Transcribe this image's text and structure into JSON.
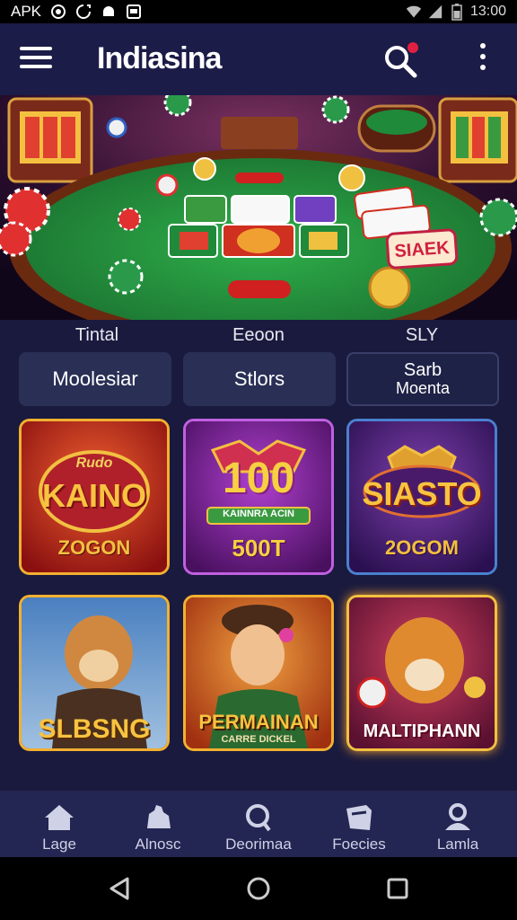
{
  "status_bar": {
    "app_label": "APK",
    "time": "13:00",
    "icons": [
      "notification-icon",
      "sync-icon",
      "android-icon",
      "image-icon",
      "wifi-icon",
      "signal-icon",
      "battery-icon"
    ]
  },
  "header": {
    "title": "Indiasina",
    "icons": [
      "menu-icon",
      "search-icon",
      "more-vert-icon"
    ],
    "notification_dot_color": "#e02040"
  },
  "tabs": [
    {
      "label": "Tintal"
    },
    {
      "label": "Eeoon"
    },
    {
      "label": "SLY"
    }
  ],
  "categories": [
    {
      "label": "Moolesiar"
    },
    {
      "label": "Stlors"
    },
    {
      "label_line1": "Sarb",
      "label_line2": "Moenta"
    }
  ],
  "games": [
    {
      "title": "KAINO",
      "subtitle": "ZOGON",
      "theme": "red",
      "ribbon": "Rudo"
    },
    {
      "title": "100",
      "subtitle": "500T",
      "theme": "purple",
      "ribbon": "KAINNRA ACIN"
    },
    {
      "title": "SIASTO",
      "subtitle": "2OGOM",
      "theme": "violet"
    },
    {
      "title": "SLBSNG",
      "theme": "puma"
    },
    {
      "title": "PERMAINAN",
      "subtitle": "CARRE DICKEL",
      "theme": "portrait"
    },
    {
      "title": "MALTIPHANN",
      "theme": "tiger"
    }
  ],
  "bottom_nav": [
    {
      "label": "Lage",
      "icon": "home-icon"
    },
    {
      "label": "Alnosc",
      "icon": "games-icon"
    },
    {
      "label": "Deorimaa",
      "icon": "search-icon"
    },
    {
      "label": "Foecies",
      "icon": "gift-icon"
    },
    {
      "label": "Lamla",
      "icon": "profile-icon"
    }
  ],
  "system_nav": [
    "back-icon",
    "home-circle-icon",
    "recents-icon"
  ],
  "colors": {
    "background": "#1a1a3e",
    "header": "#1c1c48",
    "nav": "#232552",
    "gold": "#f2c14e",
    "table_green": "#1f8a3a"
  }
}
